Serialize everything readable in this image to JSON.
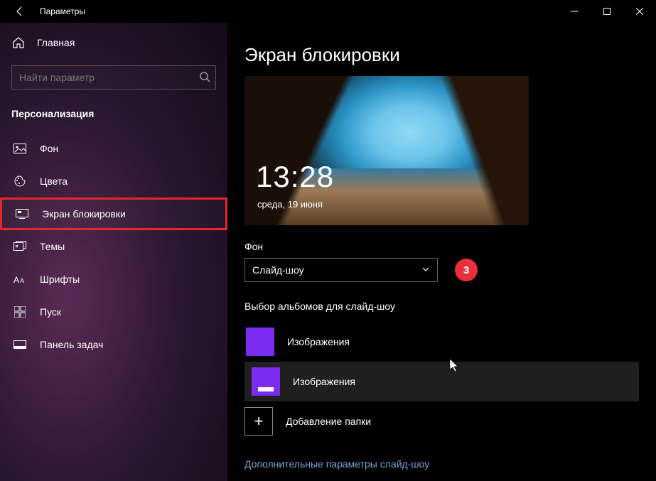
{
  "titlebar": {
    "label": "Параметры"
  },
  "sidebar": {
    "home": "Главная",
    "search_placeholder": "Найти параметр",
    "category": "Персонализация",
    "items": [
      {
        "label": "Фон",
        "icon": "picture"
      },
      {
        "label": "Цвета",
        "icon": "palette"
      },
      {
        "label": "Экран блокировки",
        "icon": "lockscreen",
        "highlighted": true
      },
      {
        "label": "Темы",
        "icon": "themes"
      },
      {
        "label": "Шрифты",
        "icon": "fonts"
      },
      {
        "label": "Пуск",
        "icon": "start"
      },
      {
        "label": "Панель задач",
        "icon": "taskbar"
      }
    ]
  },
  "main": {
    "title": "Экран блокировки",
    "preview": {
      "time": "13:28",
      "date": "среда, 19 июня"
    },
    "background_label": "Фон",
    "background_value": "Слайд-шоу",
    "annotation_badge": "3",
    "albums_label": "Выбор альбомов для слайд-шоу",
    "albums": [
      {
        "label": "Изображения"
      },
      {
        "label": "Изображения",
        "hover": true
      }
    ],
    "add_folder": "Добавление папки",
    "advanced_link": "Дополнительные параметры слайд-шоу"
  }
}
